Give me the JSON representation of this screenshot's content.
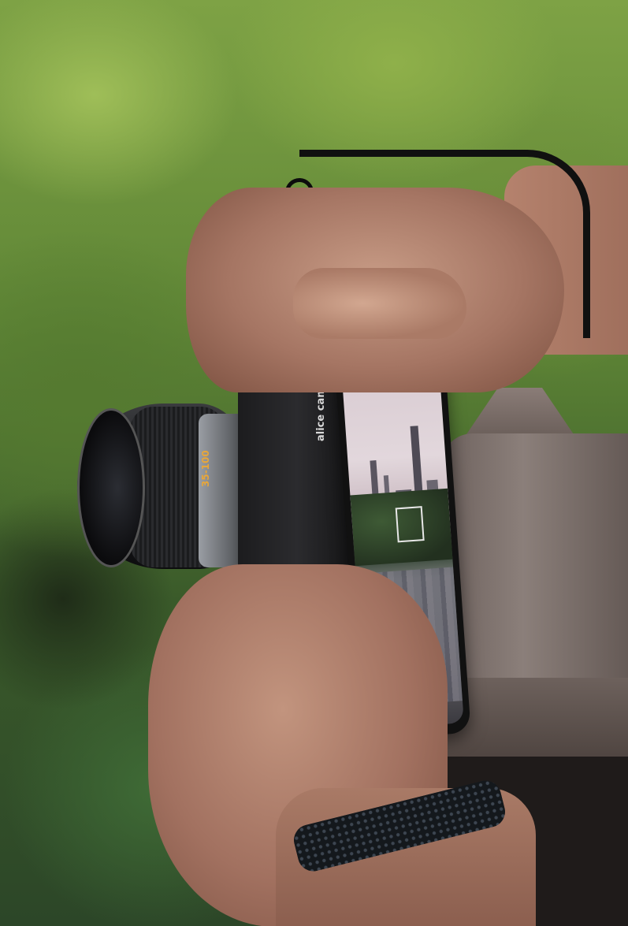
{
  "image": {
    "subject": "hands holding a smartphone camera accessory with lens",
    "lens": {
      "label": "35-100"
    },
    "accessory": {
      "brand_text": "alice camera"
    },
    "phone_screen": {
      "accent_color": "#33c6b8",
      "icons": [
        "settings-gear-icon",
        "shutter-dot-icon"
      ]
    }
  }
}
